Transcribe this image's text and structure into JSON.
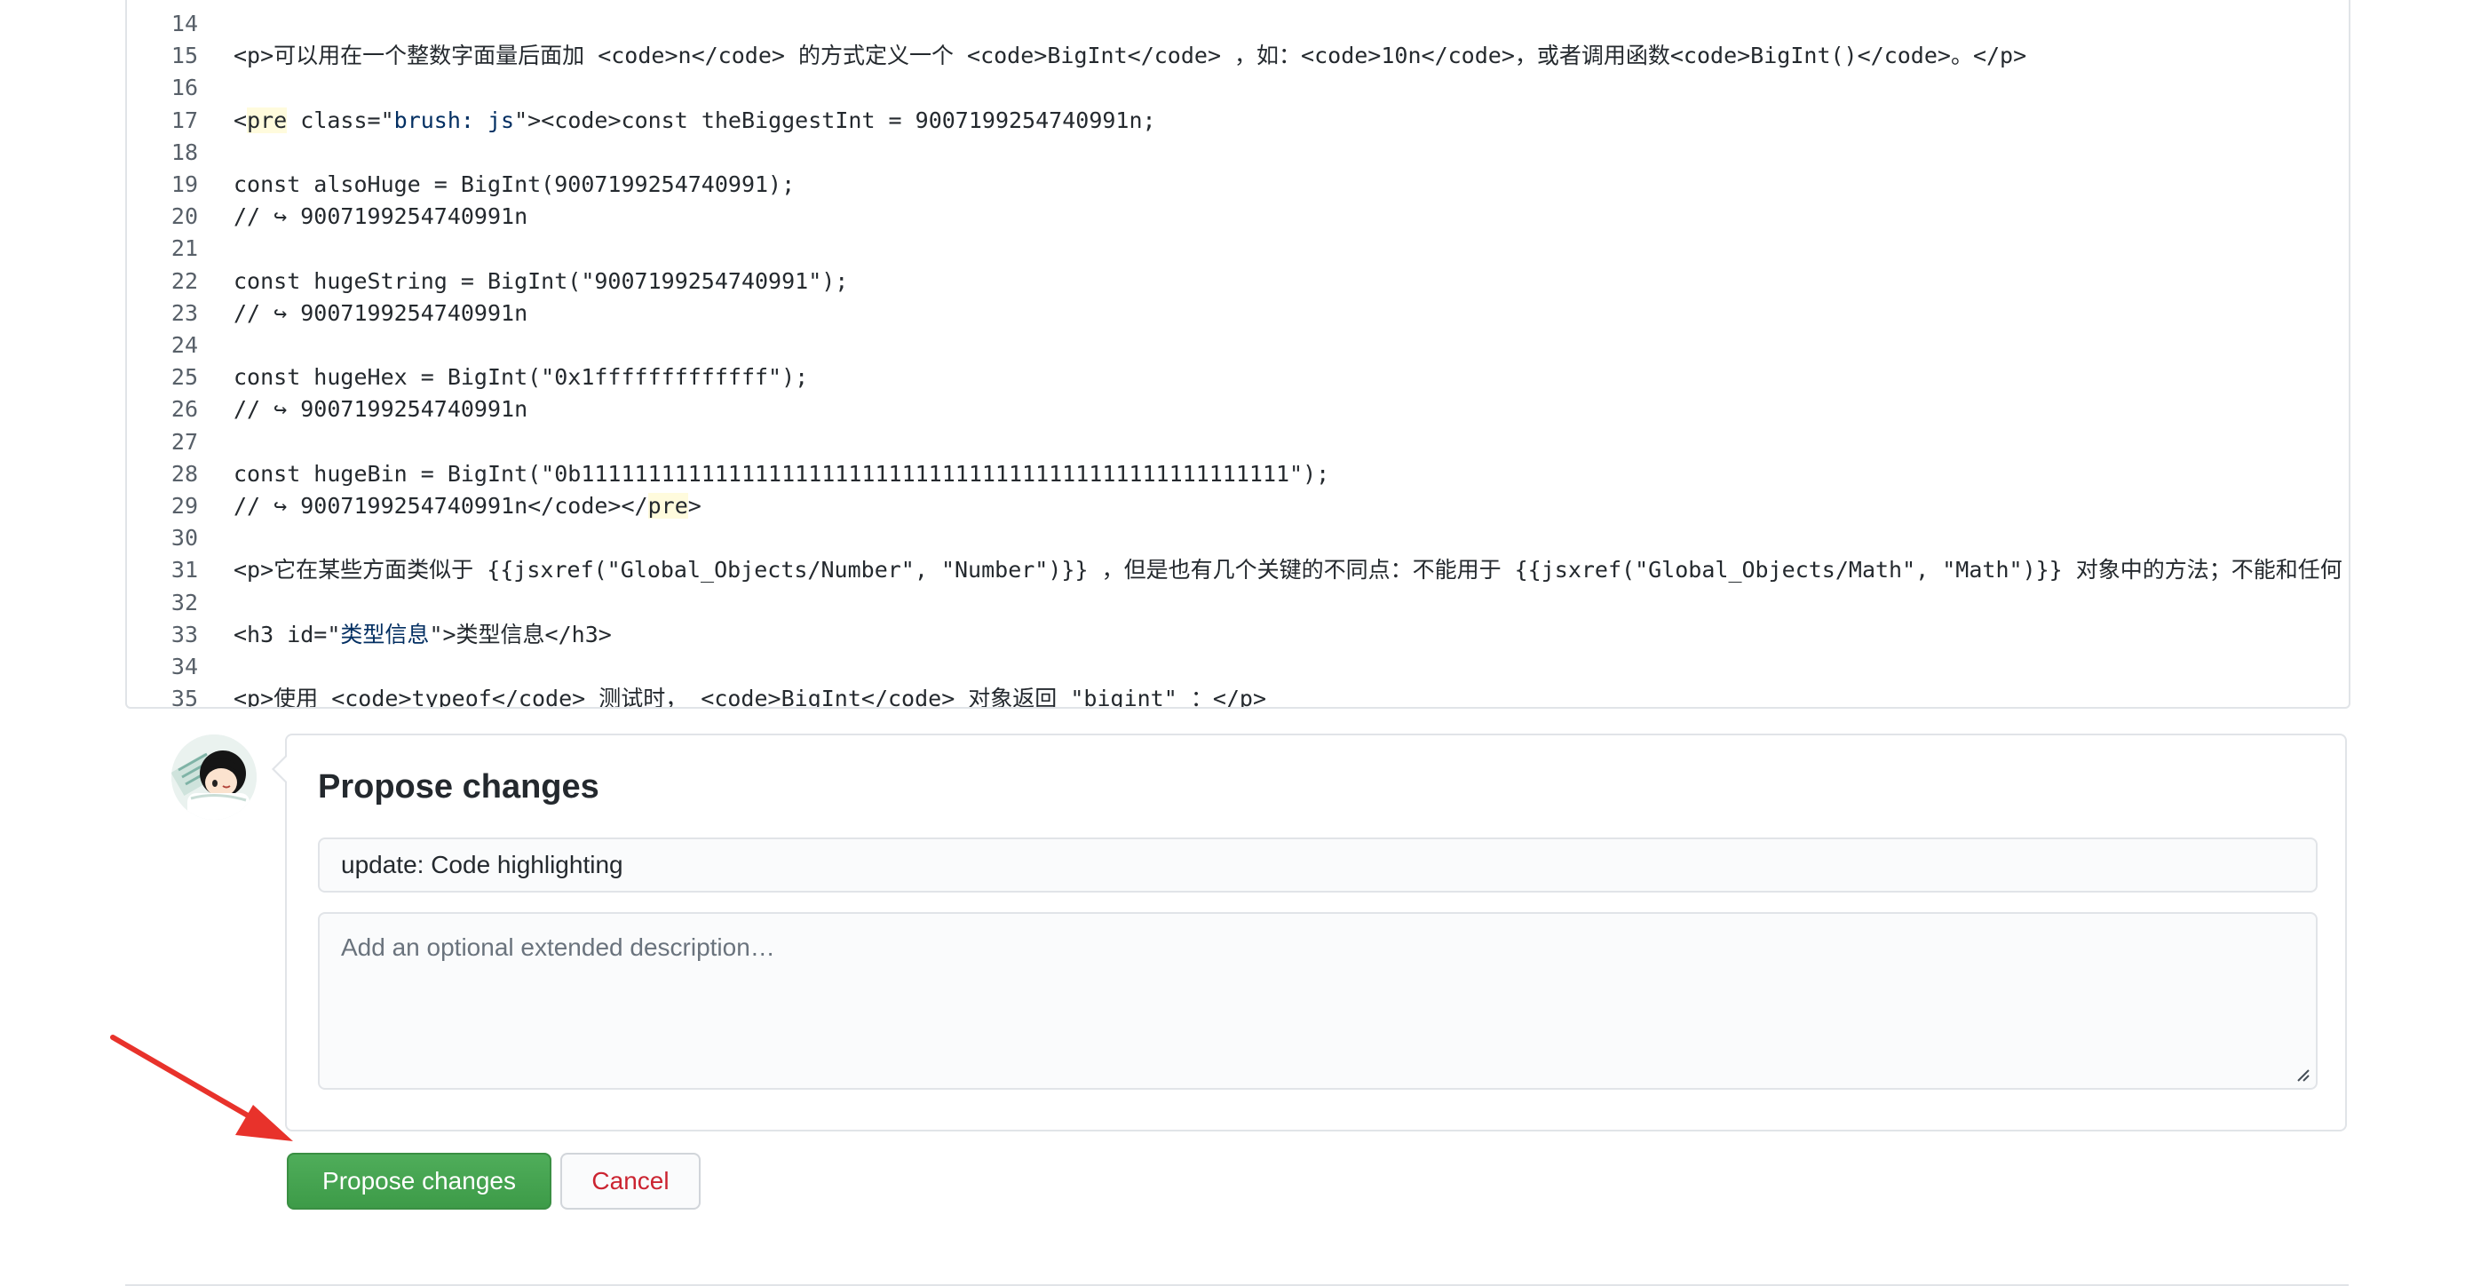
{
  "code_lines": [
    {
      "n": "14",
      "parts": [
        {
          "t": ""
        }
      ]
    },
    {
      "n": "15",
      "parts": [
        {
          "t": "<p>可以用在一个整数字面量后面加 <code>n</code> 的方式定义一个 <code>BigInt</code> ，如：<code>10n</code>，或者调用函数<code>BigInt()</code>。</p>"
        }
      ]
    },
    {
      "n": "16",
      "parts": [
        {
          "t": ""
        }
      ]
    },
    {
      "n": "17",
      "parts": [
        {
          "t": "<"
        },
        {
          "t": "pre",
          "c": "hl-tag"
        },
        {
          "t": " class=\""
        },
        {
          "t": "brush: js",
          "c": "hl-str"
        },
        {
          "t": "\"><code>const theBiggestInt = 9007199254740991n;"
        }
      ]
    },
    {
      "n": "18",
      "parts": [
        {
          "t": ""
        }
      ]
    },
    {
      "n": "19",
      "parts": [
        {
          "t": "const alsoHuge = BigInt(9007199254740991);"
        }
      ]
    },
    {
      "n": "20",
      "parts": [
        {
          "t": "// ↪ 9007199254740991n"
        }
      ]
    },
    {
      "n": "21",
      "parts": [
        {
          "t": ""
        }
      ]
    },
    {
      "n": "22",
      "parts": [
        {
          "t": "const hugeString = BigInt(\"9007199254740991\");"
        }
      ]
    },
    {
      "n": "23",
      "parts": [
        {
          "t": "// ↪ 9007199254740991n"
        }
      ]
    },
    {
      "n": "24",
      "parts": [
        {
          "t": ""
        }
      ]
    },
    {
      "n": "25",
      "parts": [
        {
          "t": "const hugeHex = BigInt(\"0x1fffffffffffff\");"
        }
      ]
    },
    {
      "n": "26",
      "parts": [
        {
          "t": "// ↪ 9007199254740991n"
        }
      ]
    },
    {
      "n": "27",
      "parts": [
        {
          "t": ""
        }
      ]
    },
    {
      "n": "28",
      "parts": [
        {
          "t": "const hugeBin = BigInt(\"0b11111111111111111111111111111111111111111111111111111\");"
        }
      ]
    },
    {
      "n": "29",
      "parts": [
        {
          "t": "// ↪ 9007199254740991n</code></"
        },
        {
          "t": "pre",
          "c": "hl-tag"
        },
        {
          "t": ">"
        }
      ]
    },
    {
      "n": "30",
      "parts": [
        {
          "t": ""
        }
      ]
    },
    {
      "n": "31",
      "parts": [
        {
          "t": "<p>它在某些方面类似于 {{jsxref(\"Global_Objects/Number\", \"Number\")}} ，但是也有几个关键的不同点：不能用于 {{jsxref(\"Global_Objects/Math\", \"Math\")}} 对象中的方法；不能和任何 {{jsxref(\"Global_Objects/Number\", \"Number\")}} 实例混合运算"
        }
      ]
    },
    {
      "n": "32",
      "parts": [
        {
          "t": ""
        }
      ]
    },
    {
      "n": "33",
      "parts": [
        {
          "t": "<h3 id=\""
        },
        {
          "t": "类型信息",
          "c": "hl-str"
        },
        {
          "t": "\">类型信息</h3>"
        }
      ]
    },
    {
      "n": "34",
      "parts": [
        {
          "t": ""
        }
      ]
    },
    {
      "n": "35",
      "parts": [
        {
          "t": "<p>使用 <code>typeof</code> 测试时， <code>BigInt</code> 对象返回 \"bigint\" ：</p>"
        }
      ]
    }
  ],
  "propose": {
    "title": "Propose changes",
    "summary_value": "update: Code highlighting",
    "description_placeholder": "Add an optional extended description…",
    "description_value": ""
  },
  "buttons": {
    "propose_label": "Propose changes",
    "cancel_label": "Cancel"
  },
  "colors": {
    "primary_button": "#3d9b48",
    "cancel_text": "#cb2431",
    "annotation_arrow": "#e8322b"
  },
  "icons": {
    "avatar": "user-avatar",
    "annotation": "red-arrow-icon",
    "resize": "resize-grip-icon"
  }
}
